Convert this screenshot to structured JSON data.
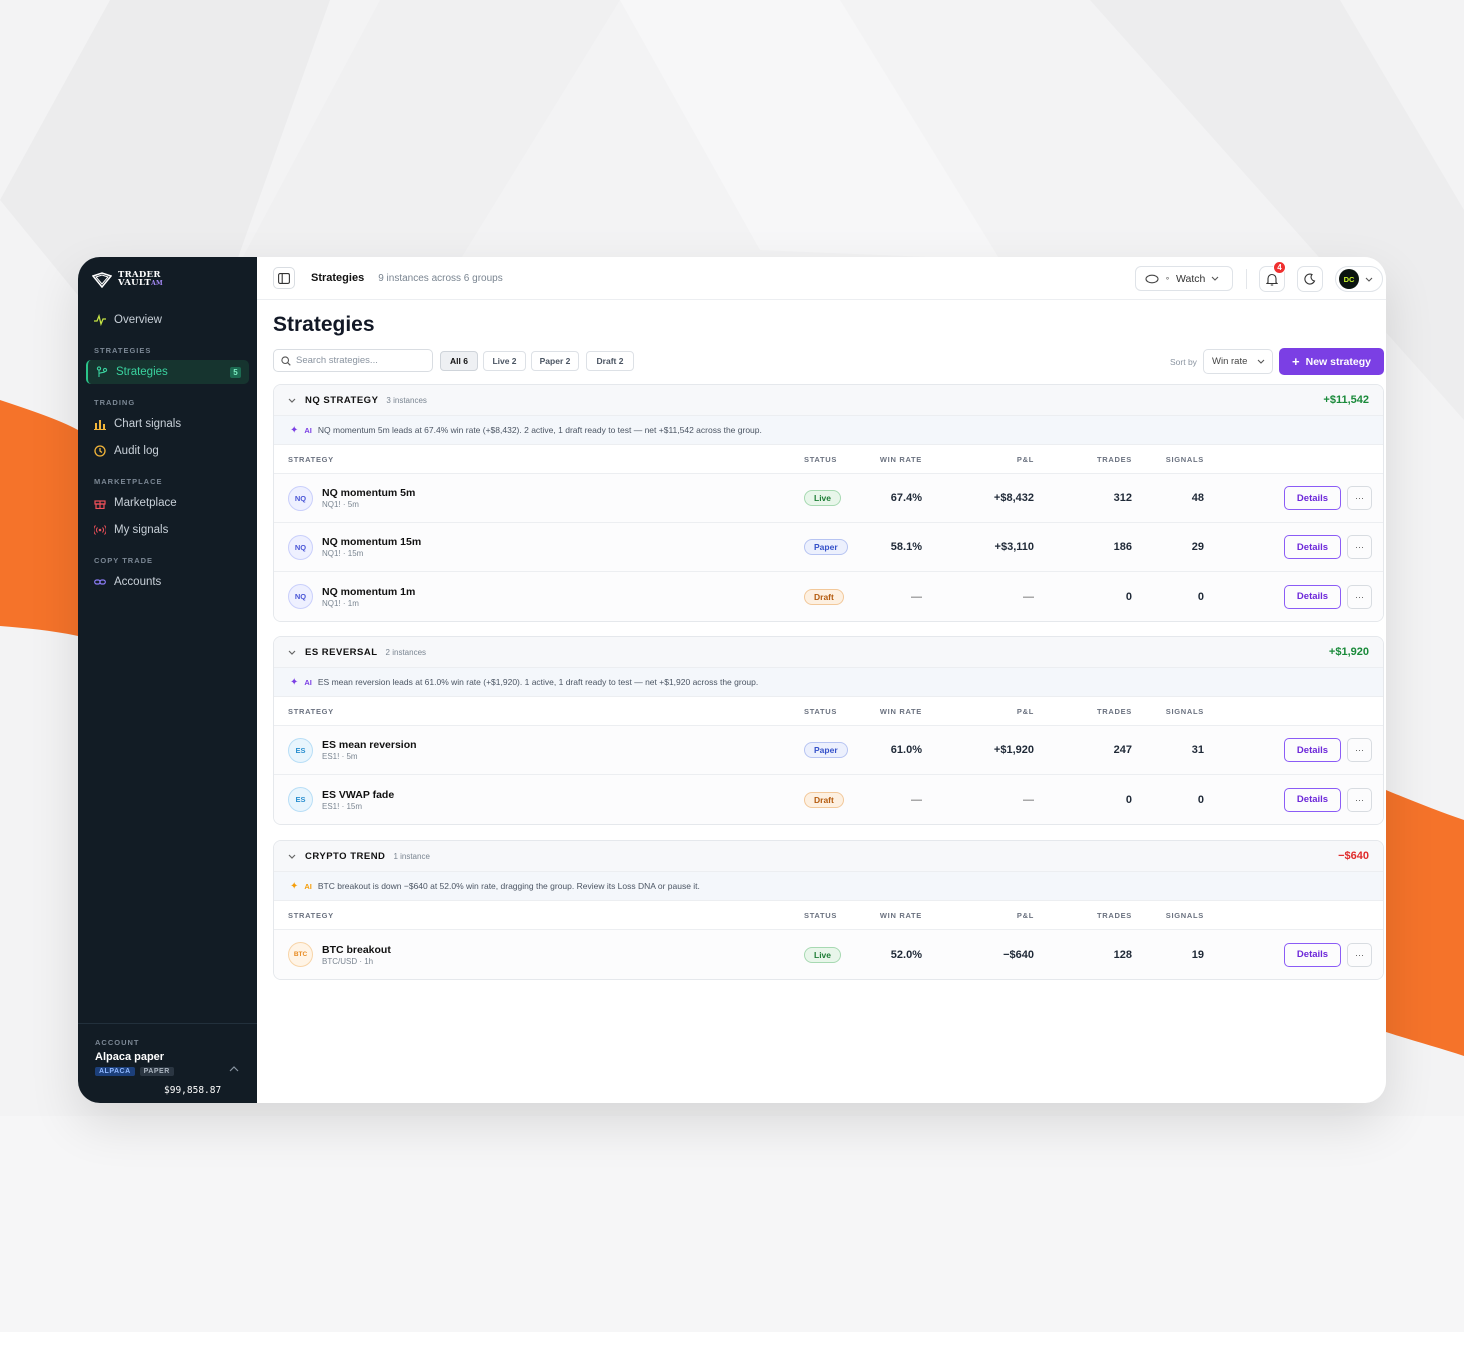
{
  "brand": {
    "line1": "TRADER",
    "line2": "VAULT",
    "suffix": "AM"
  },
  "sidebar": {
    "overview": "Overview",
    "sections": {
      "strategies": "STRATEGIES",
      "trading": "TRADING",
      "marketplace": "MARKETPLACE",
      "copy_trade": "COPY TRADE"
    },
    "items": {
      "strategies": {
        "label": "Strategies",
        "badge": "5"
      },
      "chart_signals": "Chart signals",
      "audit_log": "Audit log",
      "marketplace": "Marketplace",
      "my_signals": "My signals",
      "accounts": "Accounts"
    },
    "account": {
      "label": "ACCOUNT",
      "name": "Alpaca paper",
      "tags": [
        "ALPACA",
        "PAPER"
      ],
      "balance": "$99,858.87"
    }
  },
  "topbar": {
    "title": "Strategies",
    "subtitle": "9 instances across 6 groups",
    "watch_label": "Watch",
    "notifications": "4",
    "avatar": "DC"
  },
  "page": {
    "title": "Strategies",
    "search_placeholder": "Search strategies...",
    "filters": [
      "All 6",
      "Live 2",
      "Paper 2",
      "Draft 2"
    ],
    "sort_label": "Sort by",
    "sort_value": "Win rate",
    "new_button": "New strategy"
  },
  "columns": {
    "strategy": "STRATEGY",
    "status": "STATUS",
    "win_rate": "WIN RATE",
    "pnl": "P&L",
    "trades": "TRADES",
    "signals": "SIGNALS"
  },
  "row_actions": {
    "details": "Details",
    "more": "···"
  },
  "groups": [
    {
      "name": "NQ STRATEGY",
      "count": "3 instances",
      "total": "+$11,542",
      "total_sign": "pos",
      "ai_tag": "AI",
      "ai_color": "#7b3fe4",
      "ai_text": "NQ momentum 5m leads at 67.4% win rate (+$8,432). 2 active, 1 draft ready to test — net +$11,542 across the group.",
      "rows": [
        {
          "symbol": "NQ",
          "name": "NQ momentum 5m",
          "sub": "NQ1! · 5m",
          "status": "Live",
          "win_rate": "67.4%",
          "pnl": "+$8,432",
          "pnl_sign": "pos",
          "trades": "312",
          "signals": "48"
        },
        {
          "symbol": "NQ",
          "name": "NQ momentum 15m",
          "sub": "NQ1! · 15m",
          "status": "Paper",
          "win_rate": "58.1%",
          "pnl": "+$3,110",
          "pnl_sign": "pos",
          "trades": "186",
          "signals": "29"
        },
        {
          "symbol": "NQ",
          "name": "NQ momentum 1m",
          "sub": "NQ1! · 1m",
          "status": "Draft",
          "win_rate": "—",
          "pnl": "—",
          "pnl_sign": "none",
          "trades": "0",
          "signals": "0"
        }
      ]
    },
    {
      "name": "ES REVERSAL",
      "count": "2 instances",
      "total": "+$1,920",
      "total_sign": "pos",
      "ai_tag": "AI",
      "ai_color": "#7b3fe4",
      "ai_text": "ES mean reversion leads at 61.0% win rate (+$1,920). 1 active, 1 draft ready to test — net +$1,920 across the group.",
      "rows": [
        {
          "symbol": "ES",
          "name": "ES mean reversion",
          "sub": "ES1! · 5m",
          "status": "Paper",
          "win_rate": "61.0%",
          "pnl": "+$1,920",
          "pnl_sign": "pos",
          "trades": "247",
          "signals": "31"
        },
        {
          "symbol": "ES",
          "name": "ES VWAP fade",
          "sub": "ES1! · 15m",
          "status": "Draft",
          "win_rate": "—",
          "pnl": "—",
          "pnl_sign": "none",
          "trades": "0",
          "signals": "0"
        }
      ]
    },
    {
      "name": "CRYPTO TREND",
      "count": "1 instance",
      "total": "−$640",
      "total_sign": "neg",
      "ai_tag": "AI",
      "ai_color": "#f59e0b",
      "ai_text": "BTC breakout is down −$640 at 52.0% win rate, dragging the group. Review its Loss DNA or pause it.",
      "rows": [
        {
          "symbol": "BTC",
          "name": "BTC breakout",
          "sub": "BTC/USD · 1h",
          "status": "Live",
          "win_rate": "52.0%",
          "pnl": "−$640",
          "pnl_sign": "neg",
          "trades": "128",
          "signals": "19"
        }
      ]
    }
  ],
  "colors": {
    "accent": "#7b3fe4",
    "sidebar_bg": "#121c25",
    "active_green": "#3ad29f",
    "orange_bg": "#f5732a"
  }
}
